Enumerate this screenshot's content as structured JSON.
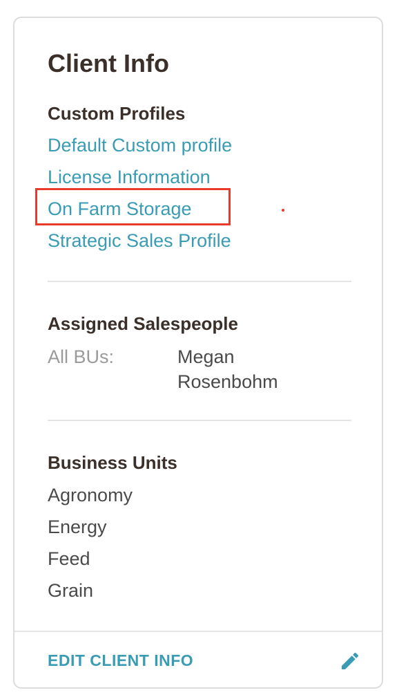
{
  "card": {
    "title": "Client Info"
  },
  "custom_profiles": {
    "heading": "Custom Profiles",
    "items": [
      {
        "label": "Default Custom profile"
      },
      {
        "label": "License Information"
      },
      {
        "label": "On Farm Storage"
      },
      {
        "label": "Strategic Sales Profile"
      }
    ]
  },
  "assigned_salespeople": {
    "heading": "Assigned Salespeople",
    "label": "All BUs:",
    "value": "Megan Rosenbohm"
  },
  "business_units": {
    "heading": "Business Units",
    "items": [
      "Agronomy",
      "Energy",
      "Feed",
      "Grain"
    ]
  },
  "footer": {
    "edit_label": "EDIT CLIENT INFO",
    "edit_icon": "pencil-icon"
  },
  "colors": {
    "accent": "#3a9bb4",
    "heading": "#3b2f2a",
    "highlight": "#e8392a"
  }
}
